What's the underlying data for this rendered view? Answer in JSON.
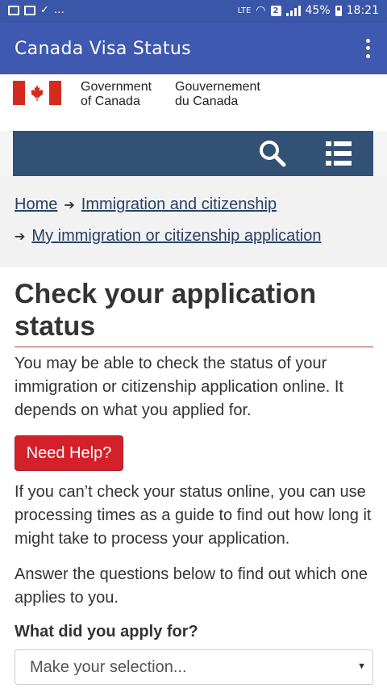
{
  "status_bar": {
    "network": "LTE",
    "sim": "2",
    "battery": "45%",
    "time": "18:21",
    "left_icons": [
      "image-icon",
      "flipboard-icon",
      "check-icon",
      "more-notifications-icon"
    ]
  },
  "app_bar": {
    "title": "Canada Visa Status",
    "overflow_icon": "overflow-menu-icon"
  },
  "gc_header": {
    "en_line1": "Government",
    "en_line2": "of Canada",
    "fr_line1": "Gouvernement",
    "fr_line2": "du Canada",
    "flag_color": "#d52b1e"
  },
  "nav": {
    "bg_color": "#335075",
    "search_icon": "search-icon",
    "menu_icon": "menu-list-icon"
  },
  "breadcrumb": {
    "home": "Home",
    "level1": "Immigration and citizenship",
    "level2": "My immigration or citizenship application"
  },
  "main": {
    "title": "Check your application status",
    "intro": "You may be able to check the status of your immigration or citizenship application online. It depends on what you applied for.",
    "help_button": "Need Help?",
    "para2": "If you can’t check your status online, you can use processing times as a guide to find out how long it might take to process your application.",
    "para3": "Answer the questions below to find out which one applies to you.",
    "question": "What did you apply for?",
    "select_value": "Make your selection...",
    "accent_color": "#af3c43",
    "button_color": "#d3202a"
  }
}
